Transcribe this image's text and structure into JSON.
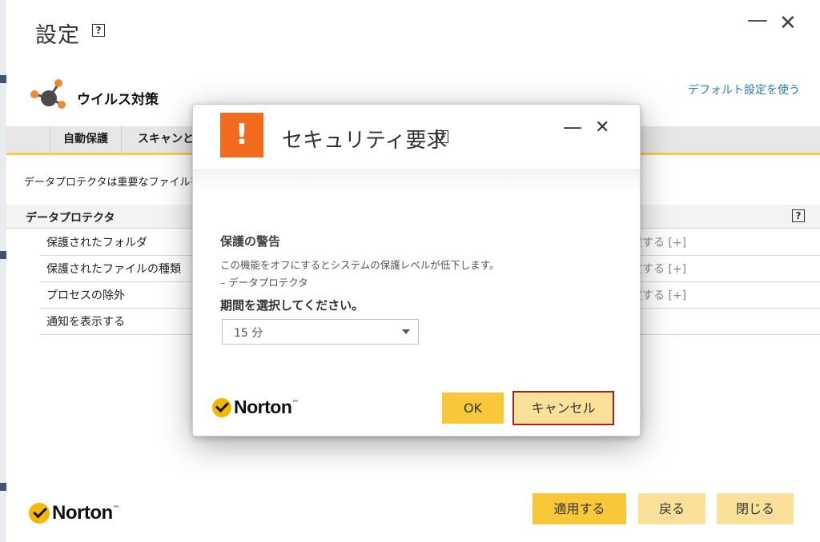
{
  "main": {
    "title": "設定",
    "help": "?",
    "window_minimize": "—",
    "window_close": "✕",
    "section_title": "ウイルス対策",
    "default_link": "デフォルト設定を使う",
    "tabs": [
      {
        "label": "自動保護"
      },
      {
        "label": "スキャンとリ"
      }
    ],
    "description": "データプロテクタは重要なファイルを設",
    "group": {
      "title": "データプロテクタ",
      "rows": [
        {
          "label": "保護されたフォルダ",
          "action": "定する [+]"
        },
        {
          "label": "保護されたファイルの種類",
          "action": "定する [+]"
        },
        {
          "label": "プロセスの除外",
          "action": "定する [+]"
        },
        {
          "label": "通知を表示する",
          "action": ""
        }
      ]
    },
    "buttons": {
      "apply": "適用する",
      "back": "戻る",
      "close": "閉じる"
    }
  },
  "logo": {
    "text": "Norton",
    "tm": "™",
    "check_color": "#f5b800"
  },
  "modal": {
    "badge": "!",
    "badge_color": "#f26b1d",
    "title": "セキュリティ要求",
    "warning_title": "保護の警告",
    "warning_text": "この機能をオフにするとシステムの保護レベルが低下します。",
    "warning_source": "– データプロテクタ",
    "period_label": "期間を選択してください。",
    "period_selected": "15 分",
    "ok": "OK",
    "cancel": "キャンセル"
  },
  "colors": {
    "accent_yellow": "#f8c83a",
    "light_yellow": "#fbe09a",
    "link_blue": "#2a7fb8",
    "cancel_border": "#a52020"
  }
}
